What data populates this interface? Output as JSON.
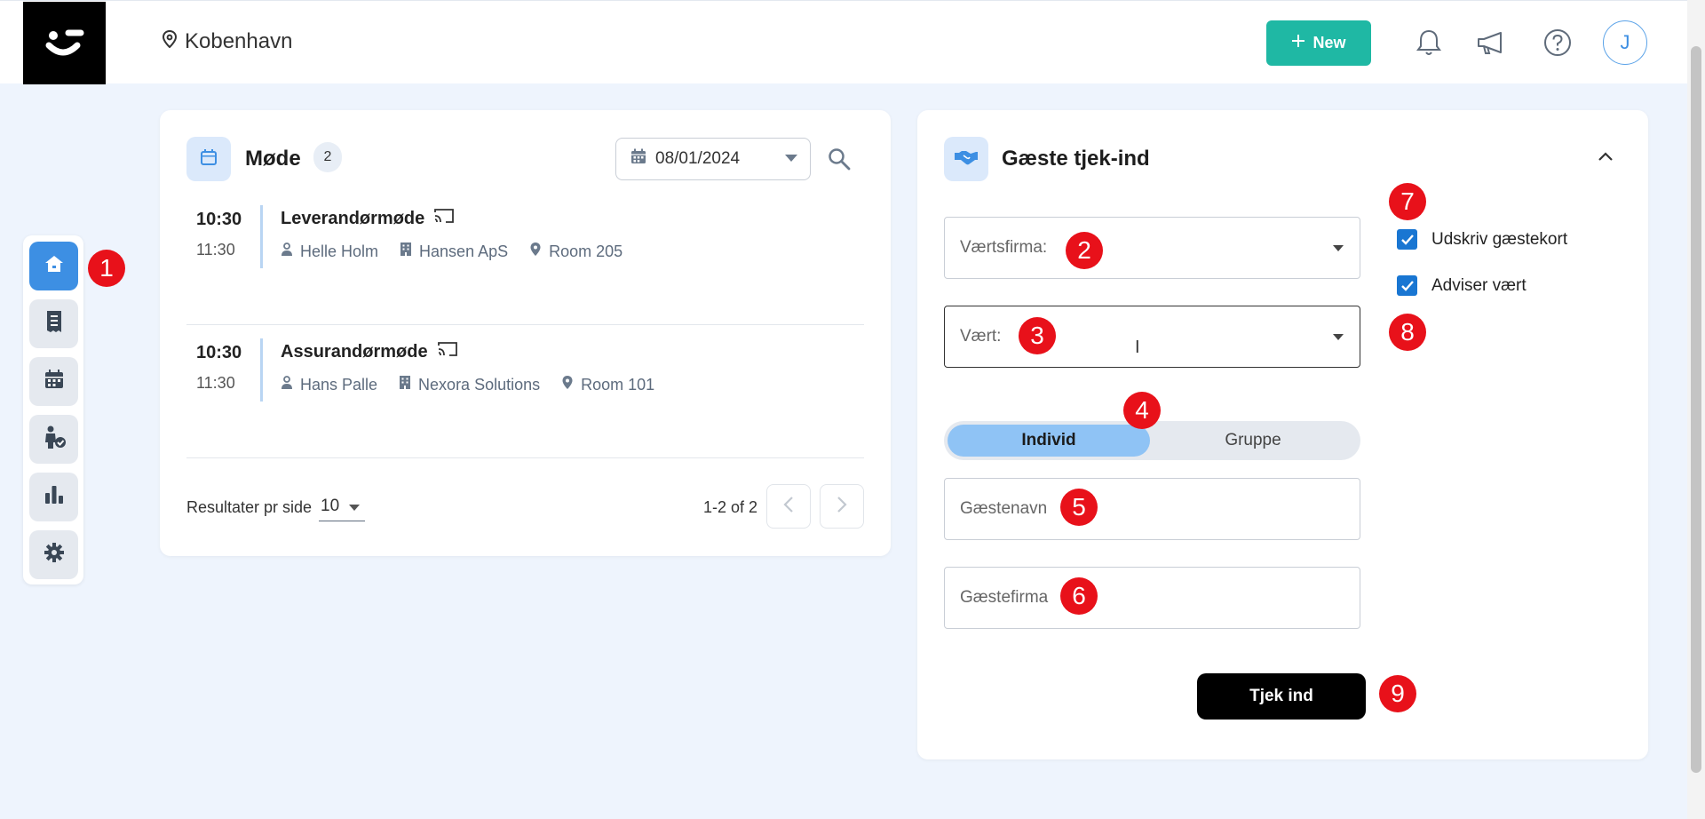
{
  "header": {
    "location": "Kobenhavn",
    "new_button": "New",
    "avatar_initial": "J"
  },
  "meetings": {
    "title": "Møde",
    "count": "2",
    "date": "08/01/2024",
    "items": [
      {
        "start": "10:30",
        "end": "11:30",
        "title": "Leverandørmøde",
        "host": "Helle Holm",
        "company": "Hansen ApS",
        "room": "Room 205"
      },
      {
        "start": "10:30",
        "end": "11:30",
        "title": "Assurandørmøde",
        "host": "Hans Palle",
        "company": "Nexora Solutions",
        "room": "Room 101"
      }
    ],
    "pager": {
      "label": "Resultater pr side",
      "per_page": "10",
      "range": "1-2 of 2"
    }
  },
  "checkin": {
    "title": "Gæste tjek-ind",
    "host_company_label": "Værtsfirma:",
    "host_label": "Vært:",
    "toggle": {
      "individual": "Individ",
      "group": "Gruppe"
    },
    "guest_name_placeholder": "Gæstenavn",
    "guest_company_placeholder": "Gæstefirma",
    "print_badge_label": "Udskriv gæstekort",
    "notify_host_label": "Adviser vært",
    "submit_label": "Tjek ind"
  },
  "markers": [
    "1",
    "2",
    "3",
    "4",
    "5",
    "6",
    "7",
    "8",
    "9"
  ],
  "colors": {
    "accent": "#1fb8a4",
    "primary": "#3d8fe3",
    "marker": "#e8111a",
    "background": "#eef4fd"
  }
}
